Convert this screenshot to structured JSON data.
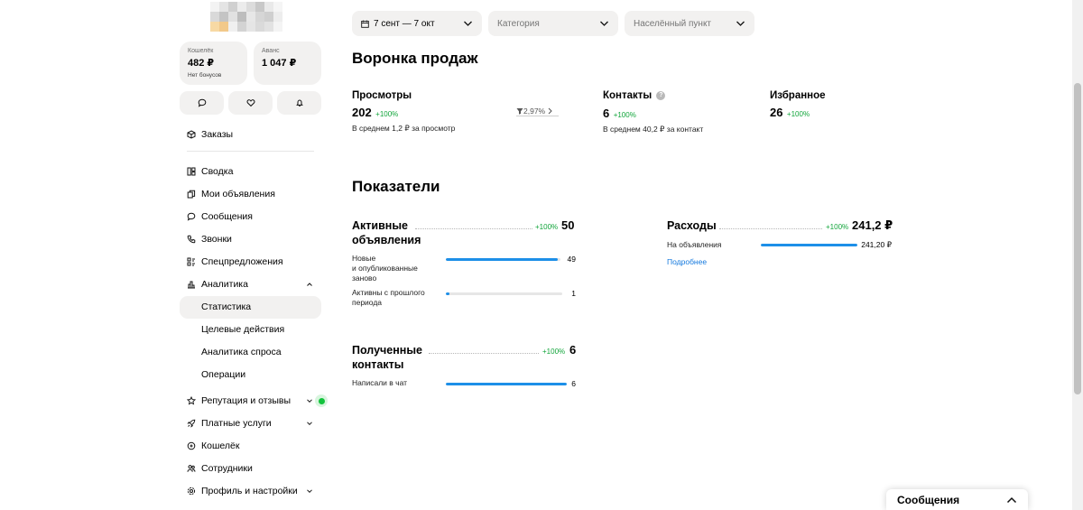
{
  "profile": {
    "wallet": {
      "caption": "Кошелёк",
      "value": "482 ₽",
      "sub": "Нет бонусов"
    },
    "advance": {
      "caption": "Аванс",
      "value": "1 047 ₽"
    }
  },
  "quick_actions": [
    {
      "icon": "chat-bubble-icon"
    },
    {
      "icon": "heart-icon"
    },
    {
      "icon": "bell-icon"
    }
  ],
  "nav": {
    "orders": "Заказы",
    "summary": "Сводка",
    "my_ads": "Мои объявления",
    "messages": "Сообщения",
    "calls": "Звонки",
    "special_offers": "Спецпредложения",
    "analytics": "Аналитика",
    "analytics_sub": [
      "Статистика",
      "Целевые действия",
      "Аналитика спроса",
      "Операции"
    ],
    "reputation": "Репутация и отзывы",
    "paid_services": "Платные услуги",
    "wallet": "Кошелёк",
    "employees": "Сотрудники",
    "profile_settings": "Профиль и настройки"
  },
  "filters": {
    "date_range": "7 сент — 7 окт",
    "category_placeholder": "Категория",
    "locality_placeholder": "Населённый пункт"
  },
  "funnel": {
    "title": "Воронка продаж",
    "views": {
      "label": "Просмотры",
      "value": "202",
      "change": "+100%",
      "hint": "В среднем 1,2 ₽ за просмотр"
    },
    "conversion": {
      "value": "2,97%"
    },
    "contacts": {
      "label": "Контакты",
      "value": "6",
      "change": "+100%",
      "hint": "В среднем 40,2 ₽ за контакт"
    },
    "favorites": {
      "label": "Избранное",
      "value": "26",
      "change": "+100%"
    }
  },
  "indicators": {
    "title": "Показатели",
    "active_ads": {
      "title_line1": "Активные",
      "title_line2": "объявления",
      "change": "+100%",
      "value": "50",
      "rows": [
        {
          "label_lines": [
            "Новые",
            "и опубликованные",
            "заново"
          ],
          "value": "49",
          "fill": 0.98
        },
        {
          "label_lines": [
            "Активны с прошлого",
            "периода"
          ],
          "value": "1",
          "fill": 0.03
        }
      ]
    },
    "expenses": {
      "title": "Расходы",
      "change": "+100%",
      "value": "241,2 ₽",
      "rows": [
        {
          "label": "На объявления",
          "value": "241,20 ₽",
          "fill": 1.0
        }
      ],
      "link": "Подробнее"
    },
    "contacts": {
      "title_line1": "Полученные",
      "title_line2": "контакты",
      "change": "+100%",
      "value": "6",
      "rows": [
        {
          "label": "Написали в чат",
          "value": "6",
          "fill": 1.0
        }
      ]
    }
  },
  "messages_bar": {
    "label": "Сообщения"
  },
  "colors": {
    "accent_blue": "#1d8fe8",
    "positive_green": "#12a53b",
    "card_gray": "#f2f1f0"
  }
}
